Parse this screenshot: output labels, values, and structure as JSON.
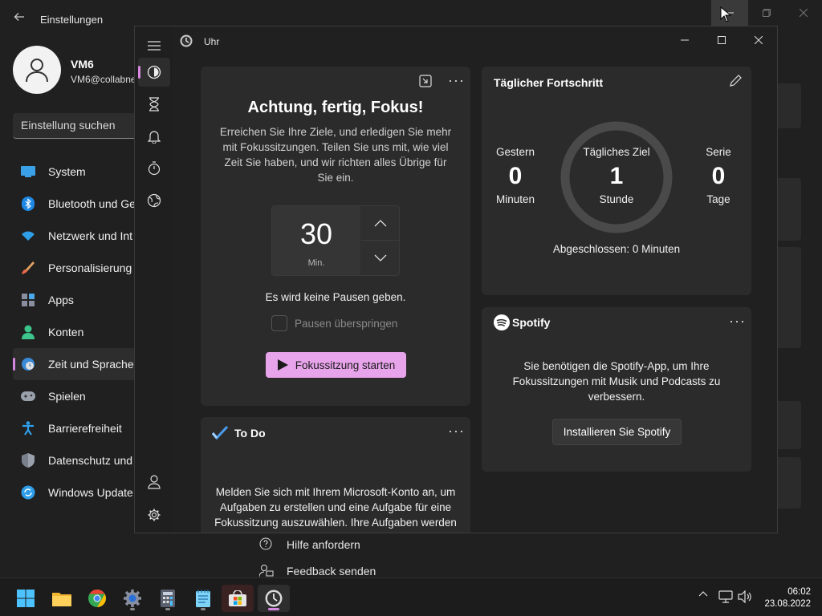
{
  "settings": {
    "title": "Einstellungen",
    "user": {
      "name": "VM6",
      "email": "VM6@collabne"
    },
    "search_placeholder": "Einstellung suchen",
    "nav": [
      {
        "label": "System",
        "icon": "system-icon"
      },
      {
        "label": "Bluetooth und Ge",
        "icon": "bluetooth-icon"
      },
      {
        "label": "Netzwerk und Int",
        "icon": "network-icon"
      },
      {
        "label": "Personalisierung",
        "icon": "brush-icon"
      },
      {
        "label": "Apps",
        "icon": "apps-icon"
      },
      {
        "label": "Konten",
        "icon": "account-icon"
      },
      {
        "label": "Zeit und Sprache",
        "icon": "time-language-icon",
        "active": true
      },
      {
        "label": "Spielen",
        "icon": "gamepad-icon"
      },
      {
        "label": "Barrierefreiheit",
        "icon": "accessibility-icon"
      },
      {
        "label": "Datenschutz und",
        "icon": "shield-icon"
      },
      {
        "label": "Windows Update",
        "icon": "update-icon"
      }
    ],
    "help": "Hilfe anfordern",
    "feedback": "Feedback senden"
  },
  "clock": {
    "title": "Uhr",
    "focus": {
      "heading": "Achtung, fertig, Fokus!",
      "description": "Erreichen Sie Ihre Ziele, und erledigen Sie mehr mit Fokussitzungen. Teilen Sie uns mit, wie viel Zeit Sie haben, und wir richten alles Übrige für Sie ein.",
      "minutes": "30",
      "unit": "Min.",
      "break_text": "Es wird keine Pausen geben.",
      "skip_label": "Pausen überspringen",
      "start_label": "Fokussitzung starten"
    },
    "todo": {
      "title": "To Do",
      "text": "Melden Sie sich mit Ihrem Microsoft-Konto an, um Aufgaben zu erstellen und eine Aufgabe für eine Fokussitzung auszuwählen. Ihre Aufgaben werden mit Microsoft To Do synchronisiert."
    },
    "progress": {
      "title": "Täglicher Fortschritt",
      "yesterday_label": "Gestern",
      "yesterday_value": "0",
      "yesterday_unit": "Minuten",
      "goal_label": "Tägliches Ziel",
      "goal_value": "1",
      "goal_unit": "Stunde",
      "streak_label": "Serie",
      "streak_value": "0",
      "streak_unit": "Tage",
      "completed": "Abgeschlossen: 0 Minuten"
    },
    "spotify": {
      "brand": "Spotify",
      "text": "Sie benötigen die Spotify-App, um Ihre Fokussitzungen mit Musik und Podcasts zu verbessern.",
      "install_label": "Installieren Sie Spotify"
    }
  },
  "taskbar": {
    "time": "06:02",
    "date": "23.08.2022"
  },
  "colors": {
    "accent": "#d688e0",
    "start_button": "#e7a4ea",
    "spotify": "#ffffff"
  }
}
